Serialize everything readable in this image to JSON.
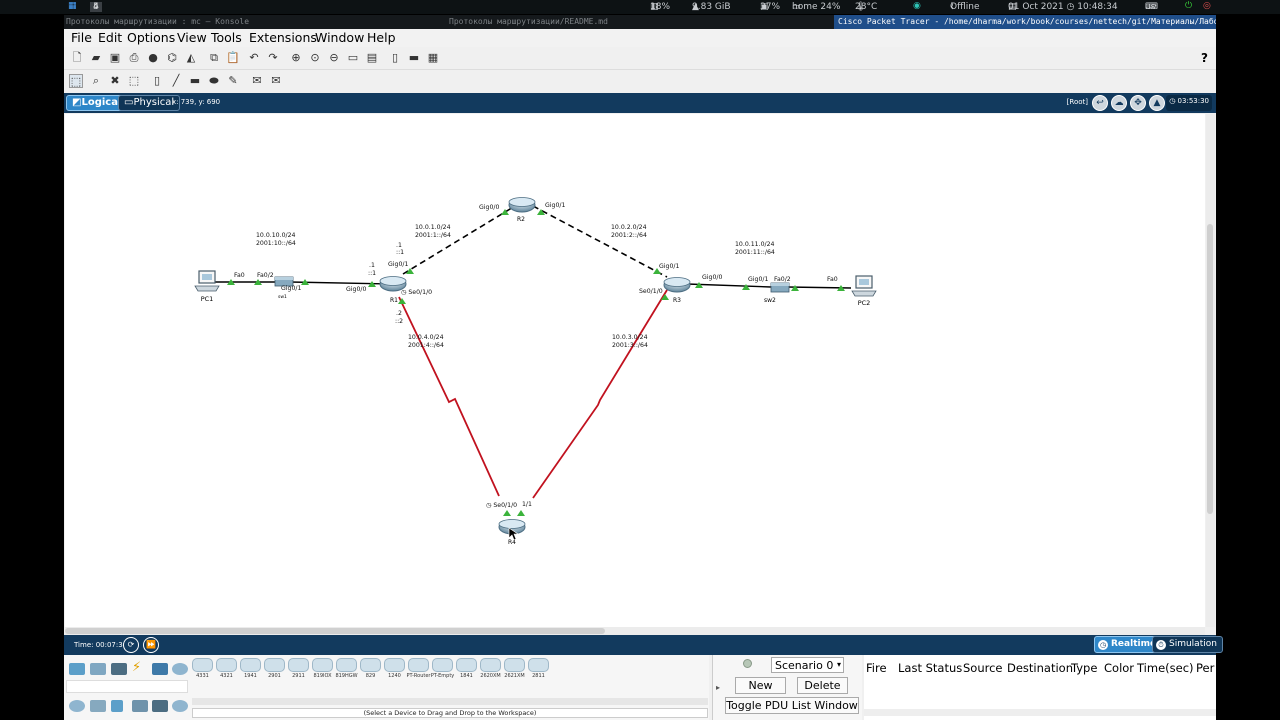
{
  "system": {
    "workspaces": [
      "2",
      "3",
      "4",
      "5"
    ],
    "active_workspace": "4",
    "cpu": "18%",
    "mem": "9.83 GiB",
    "disk": "37%",
    "home": "home 24%",
    "temp": "28°C",
    "net": "Offline",
    "datetime": "01 Oct 2021 ◷ 10:48:34",
    "layout": "us"
  },
  "titles": {
    "left": "Протоколы маршрутизации : mc — Konsole",
    "mid": "Протоколы маршрутизации/README.md",
    "window": "Cisco Packet Tracer - /home/dharma/work/book/courses/nettech/git/Материалы/Лабораторный п..."
  },
  "menu": [
    "File",
    "Edit",
    "Options",
    "View",
    "Tools",
    "Extensions",
    "Window",
    "Help"
  ],
  "workspace": {
    "logical": "Logical",
    "physical": "Physical",
    "coords": "x: 739, y: 690",
    "root": "[Root]",
    "clock": "03:53:30"
  },
  "topology": {
    "devices": {
      "pc1": "PC1",
      "sw1": "sw1",
      "r1": "R1",
      "r2": "R2",
      "r3": "R3",
      "r4": "R4",
      "sw2": "sw2",
      "pc2": "PC2"
    },
    "ports": {
      "pc1_fa0": "Fa0",
      "sw1_fa02": "Fa0/2",
      "sw1_gig01": "Gig0/1",
      "r1_gig00": "Gig0/0",
      "r1_gig01": "Gig0/1",
      "r1_se010": "Se0/1/0",
      "r2_gig00": "Gig0/0",
      "r2_gig01": "Gig0/1",
      "r3_gig01": "Gig0/1",
      "r3_gig00": "Gig0/0",
      "r3_se010": "Se0/1/0",
      "sw2_gig01": "Gig0/1",
      "sw2_fa02": "Fa0/2",
      "pc2_fa0": "Fa0",
      "r4_se010": "Se0/1/0",
      "r4_11": "1/1"
    },
    "nets": {
      "lan1_v4": "10.0.10.0/24",
      "lan1_v6": "2001:10::/64",
      "n1_v4": "10.0.1.0/24",
      "n1_v6": "2001:1::/64",
      "n2_v4": "10.0.2.0/24",
      "n2_v6": "2001:2::/64",
      "lan2_v4": "10.0.11.0/24",
      "lan2_v6": "2001:11::/64",
      "n4_v4": "10.0.4.0/24",
      "n4_v6": "2001:4::/64",
      "n3_v4": "10.0.3.0/24",
      "n3_v6": "2001:3::/64"
    },
    "addr": {
      "r1_up_v4": ".1",
      "r1_up_v6": "::1",
      "r1_mid_v4": ".1",
      "r1_mid_v6": "::1",
      "r1_dn_v4": ".2",
      "r1_dn_v6": "::2"
    }
  },
  "timebar": {
    "time": "Time: 00:07:36",
    "realtime": "Realtime",
    "simulation": "Simulation"
  },
  "palette": {
    "devices": [
      "4331",
      "4321",
      "1941",
      "2901",
      "2911",
      "819IOX",
      "819HGW",
      "829",
      "1240",
      "PT-Router",
      "PT-Empty",
      "1841",
      "2620XM",
      "2621XM",
      "2811"
    ],
    "hint": "(Select a Device to Drag and Drop to the Workspace)"
  },
  "scenario": {
    "selected": "Scenario 0",
    "new": "New",
    "delete": "Delete",
    "toggle": "Toggle PDU List Window"
  },
  "pdu_columns": [
    "Fire",
    "Last Status",
    "Source",
    "Destination",
    "Type",
    "Color",
    "Time(sec)",
    "Per"
  ],
  "colors": {
    "accent": "#2e87c9",
    "header": "#123a5e",
    "serial_link": "#c1121f",
    "port_up": "#3bb33b",
    "window_title": "#1f4e8a"
  }
}
